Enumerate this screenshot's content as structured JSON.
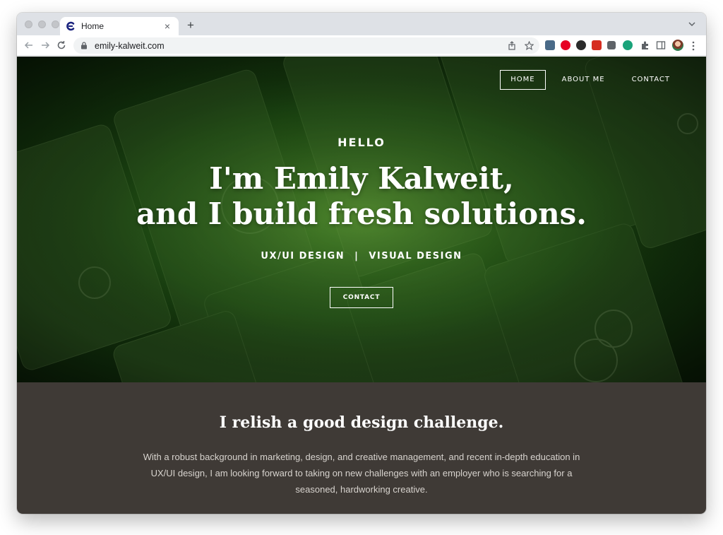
{
  "browser": {
    "tab": {
      "title": "Home"
    },
    "url": "emily-kalweit.com"
  },
  "site": {
    "nav": [
      {
        "label": "HOME",
        "active": true
      },
      {
        "label": "ABOUT ME",
        "active": false
      },
      {
        "label": "CONTACT",
        "active": false
      }
    ],
    "hero": {
      "eyebrow": "HELLO",
      "headline_line1": "I'm Emily Kalweit,",
      "headline_line2": "and I build fresh solutions.",
      "specialty_1": "UX/UI DESIGN",
      "separator": "|",
      "specialty_2": "VISUAL DESIGN",
      "cta_label": "CONTACT"
    },
    "intro": {
      "title": "I relish a good design challenge.",
      "body": "With a robust background in marketing, design, and creative management, and recent in-depth education in UX/UI design, I am looking forward to taking on new challenges with an employer who is searching for a seasoned, hardworking creative."
    }
  },
  "colors": {
    "tabstrip": "#dee1e6",
    "hero_green": "#2f6a1f",
    "intro_bg": "#3f3a36"
  }
}
